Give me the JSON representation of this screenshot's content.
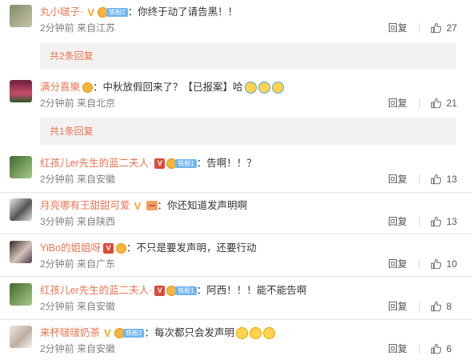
{
  "comments": [
    {
      "user": "丸小啵子·",
      "badge": "gold",
      "medal": true,
      "fan": "铁粉2",
      "text": "你终于动了请告黑！！",
      "time": "2分钟前",
      "from": "来自江苏",
      "reply": "回复",
      "likes": "27",
      "emojis": 0
    },
    {
      "user": "满分喜樂",
      "badge": "",
      "medal": true,
      "fan": "",
      "text": "中秋放假回来了？【已报案】哈",
      "time": "2分钟前",
      "from": "来自北京",
      "reply": "回复",
      "likes": "21",
      "emojis": 3
    },
    {
      "user": "红孩儿er先生的蓝二夫人·",
      "badge": "red",
      "medal": true,
      "fan": "铁粉1",
      "text": "告啊！！？",
      "time": "2分钟前",
      "from": "来自安徽",
      "reply": "回复",
      "likes": "13",
      "emojis": 0
    },
    {
      "user": "月亮哪有王甜甜可爱",
      "badge": "gold",
      "medal": false,
      "banner": true,
      "fan": "",
      "text": "你还知道发声明啊",
      "time": "3分钟前",
      "from": "来自陕西",
      "reply": "回复",
      "likes": "13",
      "emojis": 0
    },
    {
      "user": "YiBo的姐姐呀",
      "badge": "red",
      "medal": true,
      "fan": "",
      "text": "不只是要发声明，还要行动",
      "time": "2分钟前",
      "from": "来自广东",
      "reply": "回复",
      "likes": "10",
      "emojis": 0
    },
    {
      "user": "红孩儿er先生的蓝二夫人·",
      "badge": "red",
      "medal": true,
      "fan": "铁粉1",
      "text": "阿西！！！能不能告啊",
      "time": "2分钟前",
      "from": "来自安徽",
      "reply": "回复",
      "likes": "8",
      "emojis": 0
    },
    {
      "user": "来杯啵啵奶茶",
      "badge": "gold",
      "medal": true,
      "fan": "铁粉2",
      "text": "每次都只会发声明",
      "time": "2分钟前",
      "from": "来自安徽",
      "reply": "回复",
      "likes": "6",
      "emojis": 3
    }
  ],
  "more_replies": [
    "共2条回复",
    "共1条回复"
  ],
  "colors": {
    "username": "#eb7350",
    "meta": "#808080",
    "box": "#f2f2f2"
  }
}
